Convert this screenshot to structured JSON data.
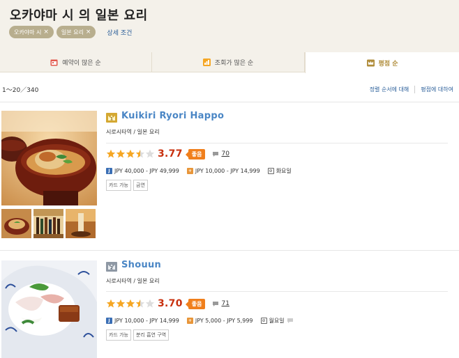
{
  "header": {
    "title": "오카야마 시 의 일본 요리",
    "chips": [
      {
        "label": "오카야마 시",
        "close": "×"
      },
      {
        "label": "일본 요리",
        "close": "×"
      }
    ],
    "detail_link": "상세 조건"
  },
  "tabs": [
    {
      "label": "예약이 많은 순",
      "icon": "calendar-icon",
      "color": "#e2574c"
    },
    {
      "label": "조회가 많은 순",
      "icon": "bar-chart-icon",
      "color": "#f5a623"
    },
    {
      "label": "평점 순",
      "icon": "crown-icon",
      "color": "#b08d3b",
      "active": true
    }
  ],
  "results": {
    "count": "1～20／340",
    "sort_about": "정렬 순서에 대해",
    "rating_about": "평점에 대하여"
  },
  "restaurants": [
    {
      "rank": "1",
      "name": "Kuikiri Ryori Happo",
      "area": "시로시타역 / 일본 요리",
      "rating": 3.5,
      "score": "3.77",
      "badge": "좋음",
      "reviews": "70",
      "dinner_price": "JPY 40,000 - JPY 49,999",
      "lunch_price": "JPY 10,000 - JPY 14,999",
      "holiday": "화요일",
      "dinner_icon": "J",
      "lunch_icon": "+",
      "holiday_icon": "⊘",
      "tags": [
        "카드 가능",
        "금연"
      ]
    },
    {
      "rank": "2",
      "name": "Shouun",
      "area": "시로시타역 / 일본 요리",
      "rating": 3.5,
      "score": "3.70",
      "badge": "좋음",
      "reviews": "71",
      "dinner_price": "JPY 10,000 - JPY 14,999",
      "lunch_price": "JPY 5,000 - JPY 5,999",
      "holiday": "월요일",
      "dinner_icon": "J",
      "lunch_icon": "+",
      "holiday_icon": "⊘",
      "tags": [
        "카드 가능",
        "분리 흡연 구역"
      ]
    }
  ],
  "colors": {
    "accent_blue": "#4a86c5",
    "score_red": "#c8300e",
    "badge_orange": "#f07f1c",
    "star": "#f5a623"
  }
}
